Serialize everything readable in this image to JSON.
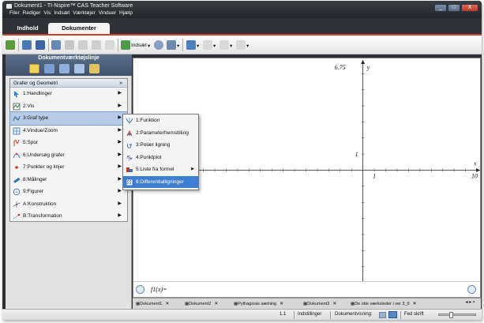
{
  "window": {
    "title": "Dokument1 - TI-Nspire™ CAS Teacher Software",
    "controls": [
      "_",
      "□",
      "X"
    ]
  },
  "menubar": [
    "Filer",
    "Rediger",
    "Vis",
    "Indsæt",
    "Værktøjer",
    "Vinduer",
    "Hjælp"
  ],
  "tabs": [
    {
      "label": "Indhold",
      "active": false
    },
    {
      "label": "Dokumenter",
      "active": true
    }
  ],
  "toolbar": {
    "insert_label": "Indsæt"
  },
  "left_panel": {
    "title": "Dokumentværktøjslinje",
    "menu_title": "Grafer og Geometri",
    "items": [
      {
        "label": "1:Handlinger",
        "icon": "pointer-icon"
      },
      {
        "label": "2:Vis",
        "icon": "view-icon"
      },
      {
        "label": "3:Graf type",
        "icon": "graph-type-icon",
        "selected": true
      },
      {
        "label": "4:Vindue/Zoom",
        "icon": "zoom-icon"
      },
      {
        "label": "5:Spor",
        "icon": "trace-icon"
      },
      {
        "label": "6:Undersøg grafer",
        "icon": "analyze-icon"
      },
      {
        "label": "7:Punkter og linjer",
        "icon": "point-icon"
      },
      {
        "label": "8:Målinger",
        "icon": "measure-icon"
      },
      {
        "label": "9:Figurer",
        "icon": "shape-icon"
      },
      {
        "label": "A:Konstruktion",
        "icon": "construction-icon"
      },
      {
        "label": "B:Transformation",
        "icon": "transformation-icon"
      }
    ]
  },
  "submenu": {
    "items": [
      {
        "label": "1:Funktion",
        "icon": "function-icon"
      },
      {
        "label": "2:Parameterfremstilling",
        "icon": "parametric-icon"
      },
      {
        "label": "3:Polær ligning",
        "icon": "polar-icon"
      },
      {
        "label": "4:Punktplot",
        "icon": "scatter-icon"
      },
      {
        "label": "5:Liste fra formel",
        "icon": "sequence-icon",
        "has_submenu": true
      },
      {
        "label": "6:Differentialligninger",
        "icon": "diff-eq-icon",
        "highlighted": true
      }
    ]
  },
  "graph": {
    "y_max_label": "6.75",
    "y_axis_label": "y",
    "x_axis_label": "x",
    "x_max_label": "10",
    "y_tick_label": "1",
    "x_tick_label": "1",
    "x_range": [
      -20,
      10
    ],
    "y_range": [
      -6.75,
      6.75
    ]
  },
  "entry_line": {
    "text": "f1(x)="
  },
  "page_tabs": [
    "Dokument1",
    "Dokument2",
    "Pythagoras sætning",
    "Dokument3",
    "De otte værksteder i ver 3_0"
  ],
  "status": {
    "page_number": "1.1",
    "settings_label": "Indstillinger",
    "view_label": "Dokumentvisning:",
    "font_label": "Fed skrift",
    "font_scale": 0.3
  },
  "colors": {
    "accent": "#c9432d",
    "highlight": "#3f7fd1",
    "panel_header": "#4a5d77"
  }
}
